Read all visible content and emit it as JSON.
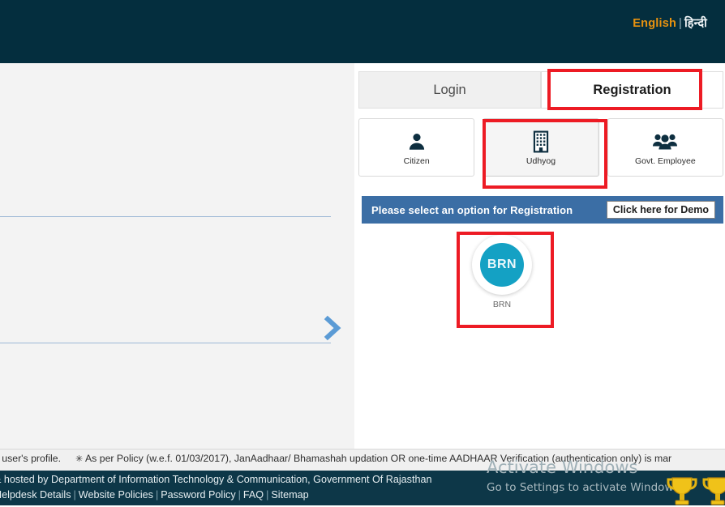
{
  "header": {
    "language": {
      "english_label": "English",
      "separator": "|",
      "hindi_label": "हिन्दी"
    }
  },
  "carousel": {
    "next_icon": "chevron-right-icon"
  },
  "panel": {
    "tabs": [
      {
        "label": "Login",
        "active": false
      },
      {
        "label": "Registration",
        "active": true
      }
    ],
    "categories": [
      {
        "label": "Citizen",
        "icon": "person-icon",
        "selected": false
      },
      {
        "label": "Udhyog",
        "icon": "building-icon",
        "selected": true
      },
      {
        "label": "Govt. Employee",
        "icon": "people-group-icon",
        "selected": false
      }
    ],
    "notice": {
      "text": "Please select an option for Registration",
      "demo_button": "Click here for Demo"
    },
    "options": [
      {
        "badge": "BRN",
        "label": "BRN",
        "color": "#14a1c4"
      }
    ]
  },
  "annotations": {
    "accent_color": "#ed1b24",
    "boxes": [
      "registration-tab",
      "udhyog-category",
      "brn-option"
    ]
  },
  "footer": {
    "notice_part1": "n user's profile.",
    "notice_symbol": "✳",
    "notice_part2": "As per Policy (w.e.f. 01/03/2017), JanAadhaar/ Bhamashah updation OR one-time AADHAAR Verification (authentication only) is mar",
    "copyright": "& hosted by Department of Information Technology & Communication, Government Of Rajasthan",
    "links": [
      "Helpdesk Details",
      "Website Policies",
      "Password Policy",
      "FAQ",
      "Sitemap"
    ],
    "link_separator": "|"
  },
  "watermark": {
    "title": "Activate Windows",
    "subtitle": "Go to Settings to activate Windows"
  }
}
